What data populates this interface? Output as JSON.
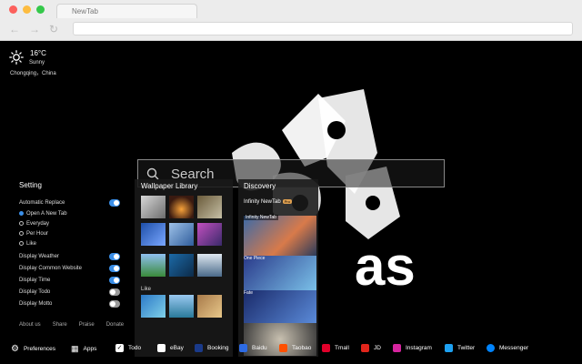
{
  "browser": {
    "tab_title": "NewTab",
    "back_icon": "back-arrow-icon",
    "forward_icon": "forward-arrow-icon",
    "reload_icon": "reload-icon",
    "traffic_colors": [
      "#fc605c",
      "#fdbc40",
      "#34c84a"
    ]
  },
  "weather": {
    "temp": "16°C",
    "condition": "Sunny",
    "city": "Chongqing，China",
    "icon": "sun-icon"
  },
  "search": {
    "placeholder": "Search",
    "icon": "search-icon"
  },
  "settings": {
    "title": "Setting",
    "automatic_replace": "Automatic Replace",
    "replace_options": [
      "Open A New Tab",
      "Everyday",
      "Per Hour",
      "Like"
    ],
    "selected_option": "Open A New Tab",
    "toggles": [
      {
        "label": "Display Weather",
        "on": true
      },
      {
        "label": "Display Common Website",
        "on": true
      },
      {
        "label": "Display Time",
        "on": true
      },
      {
        "label": "Display Todo",
        "on": false
      },
      {
        "label": "Display Motto",
        "on": false
      }
    ],
    "automatic_replace_on": true,
    "footer_links": [
      "About us",
      "Share",
      "Praise",
      "Donate"
    ],
    "accent_color": "#3b8fe8"
  },
  "wallpaper_library": {
    "title": "Wallpaper Library",
    "like_label": "Like"
  },
  "discovery": {
    "title": "Discovery",
    "header": "Infinity NewTab",
    "badge": "Pro",
    "items": [
      "Infinity NewTab",
      "One Piece",
      "Fate"
    ]
  },
  "bottom_bar": {
    "items": [
      {
        "label": "Preferences",
        "icon": "gear-icon",
        "color": "#ffffff"
      },
      {
        "label": "Apps",
        "icon": "apps-grid-icon",
        "color": "#ffffff"
      },
      {
        "label": "Todo",
        "icon": "checkbox-icon",
        "color": "#ffffff"
      },
      {
        "label": "eBay",
        "icon": "ebay-icon",
        "color": "#ffffff"
      },
      {
        "label": "Booking",
        "icon": "booking-icon",
        "color": "#1a3a8a"
      },
      {
        "label": "Baidu",
        "icon": "baidu-icon",
        "color": "#2d6be4"
      },
      {
        "label": "Taobao",
        "icon": "taobao-icon",
        "color": "#ff5000"
      },
      {
        "label": "Tmall",
        "icon": "tmall-icon",
        "color": "#e1002a"
      },
      {
        "label": "JD",
        "icon": "jd-icon",
        "color": "#e1251b"
      },
      {
        "label": "Instagram",
        "icon": "instagram-icon",
        "color": "#d6249f"
      },
      {
        "label": "Twitter",
        "icon": "twitter-icon",
        "color": "#1da1f2"
      },
      {
        "label": "Messenger",
        "icon": "messenger-icon",
        "color": "#0084ff"
      }
    ]
  }
}
